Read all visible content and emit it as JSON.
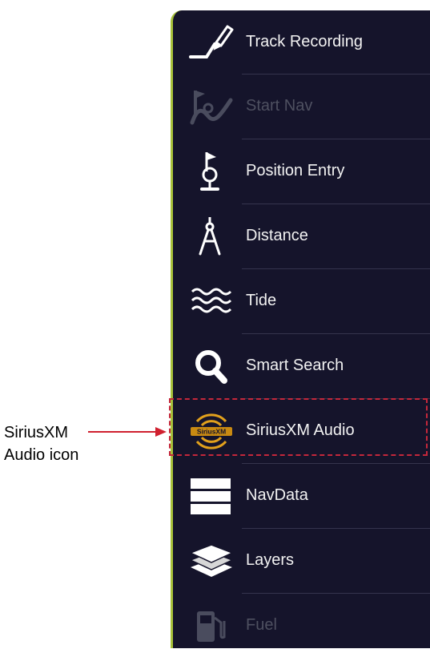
{
  "menu": {
    "items": [
      {
        "label": "Track Recording",
        "icon": "track-recording-icon",
        "enabled": true
      },
      {
        "label": "Start Nav",
        "icon": "start-nav-icon",
        "enabled": false
      },
      {
        "label": "Position Entry",
        "icon": "position-entry-icon",
        "enabled": true
      },
      {
        "label": "Distance",
        "icon": "distance-compass-icon",
        "enabled": true
      },
      {
        "label": "Tide",
        "icon": "tide-waves-icon",
        "enabled": true
      },
      {
        "label": "Smart Search",
        "icon": "magnifier-icon",
        "enabled": true
      },
      {
        "label": "SiriusXM Audio",
        "icon": "siriusxm-audio-icon",
        "enabled": true
      },
      {
        "label": "NavData",
        "icon": "navdata-icon",
        "enabled": true
      },
      {
        "label": "Layers",
        "icon": "layers-icon",
        "enabled": true
      },
      {
        "label": "Fuel",
        "icon": "fuel-pump-icon",
        "enabled": false
      }
    ]
  },
  "siriusxm_logo_text": "SiriusXM",
  "callout": {
    "line1": "SiriusXM",
    "line2": "Audio icon"
  },
  "colors": {
    "panel_background": "#15142b",
    "panel_accent_border": "#a7c13a",
    "label_enabled": "#f2f2f2",
    "label_disabled": "#4e5060",
    "highlight": "#c4273b",
    "siriusxm_gold": "#e2a11c"
  }
}
